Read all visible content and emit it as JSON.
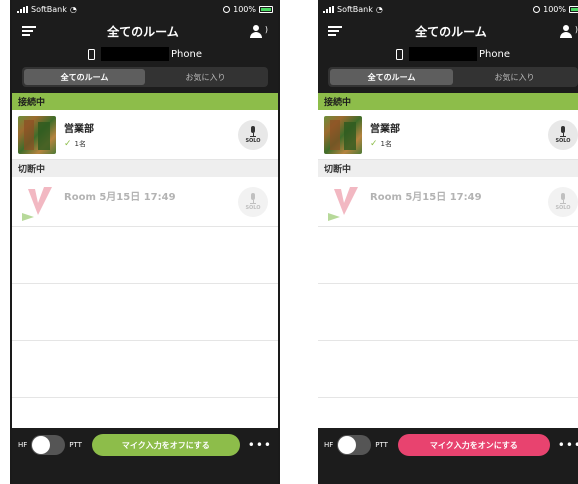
{
  "screens": [
    {
      "status": {
        "carrier": "SoftBank",
        "battery": "100%"
      },
      "nav": {
        "title": "全てのルーム"
      },
      "device": {
        "name_suffix": "Phone"
      },
      "tabs": [
        {
          "label": "全てのルーム",
          "active": true
        },
        {
          "label": "お気に入り",
          "active": false
        }
      ],
      "sections": {
        "connected": "接続中",
        "disconnected": "切断中"
      },
      "rooms_connected": [
        {
          "name": "営業部",
          "members": "1名",
          "solo": "SOLO"
        }
      ],
      "rooms_disconnected": [
        {
          "name": "Room 5月15日 17:49",
          "solo": "SOLO"
        }
      ],
      "controls": {
        "hf": "HF",
        "ptt": "PTT",
        "mic_button": "マイク入力をオフにする",
        "mic_button_color": "#8dbd4a",
        "more": "•••"
      }
    },
    {
      "status": {
        "carrier": "SoftBank",
        "battery": "100%"
      },
      "nav": {
        "title": "全てのルーム"
      },
      "device": {
        "name_suffix": "Phone"
      },
      "tabs": [
        {
          "label": "全てのルーム",
          "active": true
        },
        {
          "label": "お気に入り",
          "active": false
        }
      ],
      "sections": {
        "connected": "接続中",
        "disconnected": "切断中"
      },
      "rooms_connected": [
        {
          "name": "営業部",
          "members": "1名",
          "solo": "SOLO"
        }
      ],
      "rooms_disconnected": [
        {
          "name": "Room 5月15日 17:49",
          "solo": "SOLO"
        }
      ],
      "controls": {
        "hf": "HF",
        "ptt": "PTT",
        "mic_button": "マイク入力をオンにする",
        "mic_button_color": "#e8436f",
        "more": "•••"
      }
    }
  ],
  "colors": {
    "accent_green": "#8dbd4a",
    "accent_pink": "#e8436f",
    "dark_bg": "#1c1c1c"
  }
}
